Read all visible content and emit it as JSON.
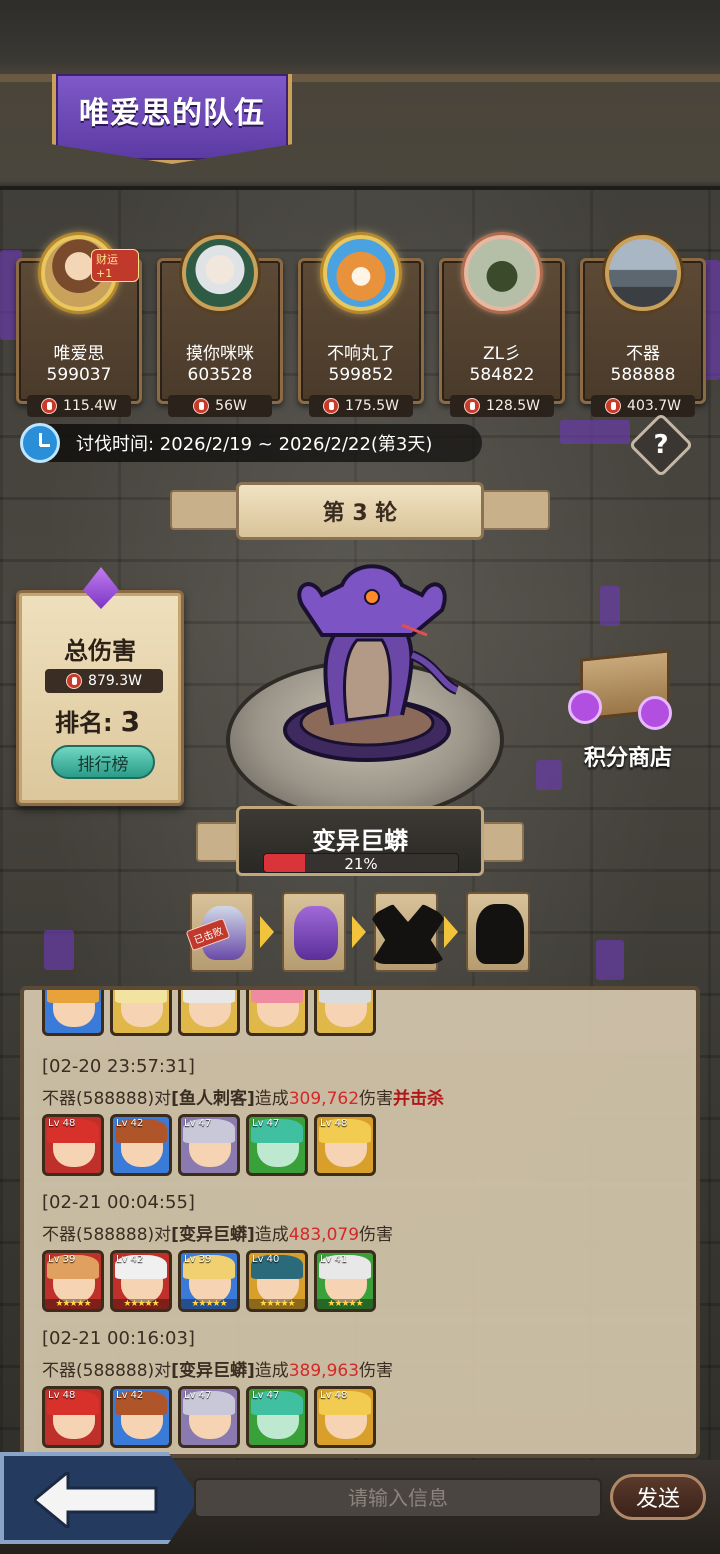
{
  "team": {
    "title": "唯爱思的队伍"
  },
  "members": [
    {
      "name": "唯爱思",
      "score": "599037",
      "damage": "115.4W",
      "badge": "财运+1"
    },
    {
      "name": "摸你咪咪",
      "score": "603528",
      "damage": "56W"
    },
    {
      "name": "不响丸了",
      "score": "599852",
      "damage": "175.5W"
    },
    {
      "name": "ZL彡",
      "score": "584822",
      "damage": "128.5W"
    },
    {
      "name": "不器",
      "score": "588888",
      "damage": "403.7W"
    }
  ],
  "time": {
    "label": "讨伐时间: 2026/2/19 ~ 2026/2/22(第3天)",
    "icon": "clock-icon"
  },
  "help": {
    "label": "?"
  },
  "round": {
    "label": "第 3 轮"
  },
  "total": {
    "title": "总伤害",
    "damage": "879.3W",
    "rank_label": "排名:",
    "rank_value": "3",
    "leaderboard_button": "排行榜"
  },
  "boss": {
    "name": "变异巨蟒",
    "hp_percent": 21,
    "hp_text": "21%"
  },
  "shop": {
    "label": "积分商店"
  },
  "stages": {
    "beaten_stamp": "已击败"
  },
  "log": [
    {
      "time": "[02-20 23:57:31]",
      "attacker": "不器(588888)对",
      "target": "[鱼人刺客]",
      "mid": "造成",
      "amount": "309,762",
      "suffix": "伤害",
      "kill": "并击杀",
      "levels": [
        "Lv 48",
        "Lv 42",
        "Lv 47",
        "Lv 47",
        "Lv 48"
      ]
    },
    {
      "time": "[02-21 00:04:55]",
      "attacker": "不器(588888)对",
      "target": "[变异巨蟒]",
      "mid": "造成",
      "amount": "483,079",
      "suffix": "伤害",
      "kill": "",
      "levels": [
        "Lv 39",
        "Lv 42",
        "Lv 39",
        "Lv 40",
        "Lv 41"
      ]
    },
    {
      "time": "[02-21 00:16:03]",
      "attacker": "不器(588888)对",
      "target": "[变异巨蟒]",
      "mid": "造成",
      "amount": "389,963",
      "suffix": "伤害",
      "kill": "",
      "levels": [
        "Lv 48",
        "Lv 42",
        "Lv 47",
        "Lv 47",
        "Lv 48"
      ]
    }
  ],
  "chat": {
    "placeholder": "请输入信息",
    "send_label": "发送"
  },
  "colors": {
    "accent_purple": "#7f5ac9",
    "damage_red": "#d62828",
    "hp_red": "#d8343a"
  }
}
